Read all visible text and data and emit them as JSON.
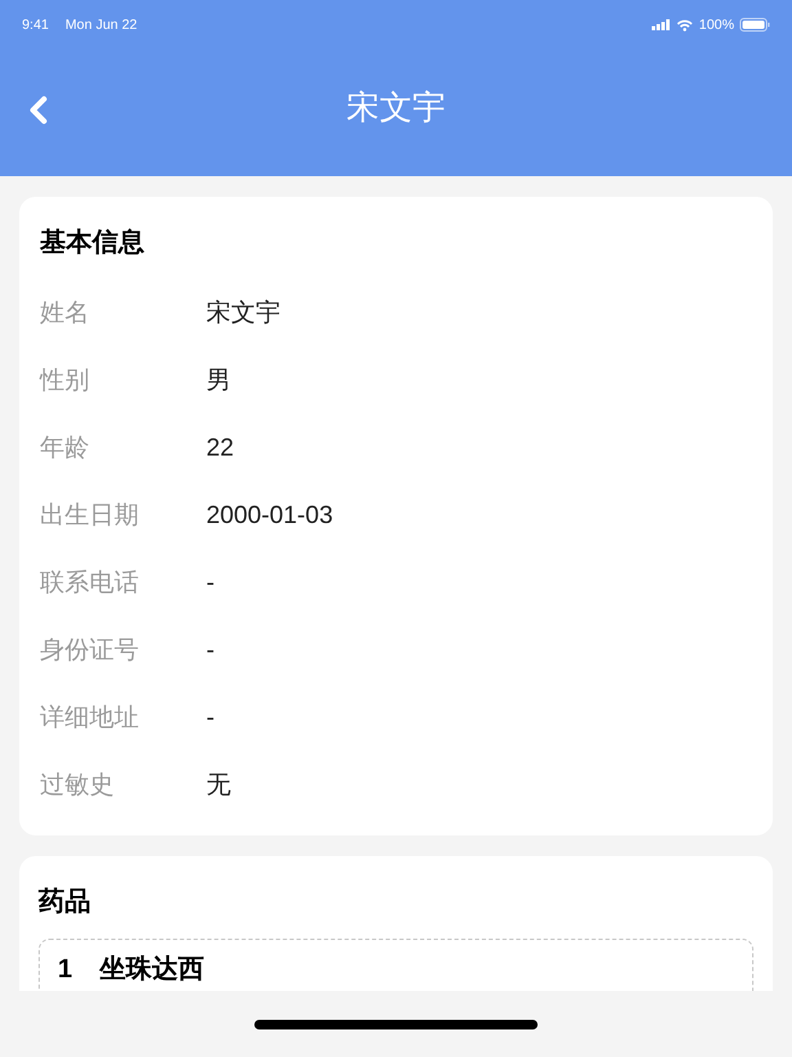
{
  "status_bar": {
    "time": "9:41",
    "date": "Mon Jun 22",
    "battery": "100%"
  },
  "header": {
    "title": "宋文宇"
  },
  "basic_info": {
    "title": "基本信息",
    "fields": [
      {
        "label": "姓名",
        "value": "宋文宇"
      },
      {
        "label": "性别",
        "value": "男"
      },
      {
        "label": "年龄",
        "value": "22"
      },
      {
        "label": "出生日期",
        "value": "2000-01-03"
      },
      {
        "label": "联系电话",
        "value": "-"
      },
      {
        "label": "身份证号",
        "value": "-"
      },
      {
        "label": "详细地址",
        "value": "-"
      },
      {
        "label": "过敏史",
        "value": "无"
      }
    ]
  },
  "medicines": {
    "title": "药品",
    "items": [
      {
        "index": "1",
        "name": "坐珠达西"
      }
    ]
  }
}
